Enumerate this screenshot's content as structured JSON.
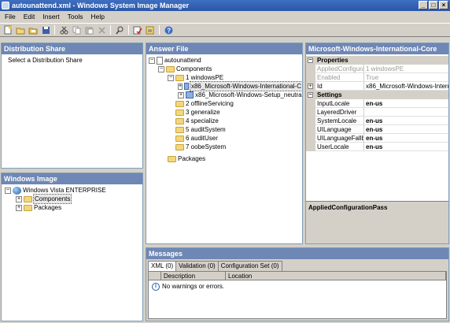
{
  "window": {
    "title": "autounattend.xml - Windows System Image Manager",
    "controls": [
      "_",
      "□",
      "×"
    ]
  },
  "menu": [
    {
      "label": "File",
      "mnemonic": "F"
    },
    {
      "label": "Edit",
      "mnemonic": "E"
    },
    {
      "label": "Insert",
      "mnemonic": "I"
    },
    {
      "label": "Tools",
      "mnemonic": "T"
    },
    {
      "label": "Help",
      "mnemonic": "H"
    }
  ],
  "toolbar": {
    "icons": [
      "new-icon",
      "open-icon",
      "open-folder-icon",
      "save-icon",
      "cut-icon",
      "copy-icon",
      "paste-icon",
      "delete-icon",
      "find-icon",
      "validate-icon",
      "create-config-set-icon",
      "help-icon"
    ]
  },
  "distribution_share": {
    "header": "Distribution Share",
    "placeholder": "Select a Distribution Share"
  },
  "windows_image": {
    "header": "Windows Image",
    "root": "Windows Vista ENTERPRISE",
    "items": [
      "Components",
      "Packages"
    ]
  },
  "answer_file": {
    "header": "Answer File",
    "root": "autounattend",
    "components_label": "Components",
    "passes": [
      {
        "label": "1 windowsPE",
        "children": [
          "x86_Microsoft-Windows-International-C",
          "x86_Microsoft-Windows-Setup_neutra"
        ]
      },
      {
        "label": "2 offlineServicing"
      },
      {
        "label": "3 generalize"
      },
      {
        "label": "4 specialize"
      },
      {
        "label": "5 auditSystem"
      },
      {
        "label": "6 auditUser"
      },
      {
        "label": "7 oobeSystem"
      }
    ],
    "packages_label": "Packages"
  },
  "properties": {
    "header": "Microsoft-Windows-International-Core",
    "categories": {
      "properties": "Properties",
      "settings": "Settings"
    },
    "property_rows": [
      {
        "name": "AppliedConfigura",
        "value": "1 windowsPE",
        "gray": true
      },
      {
        "name": "Enabled",
        "value": "True",
        "gray": true
      },
      {
        "name": "Id",
        "value": "x86_Microsoft-Windows-Internat",
        "gray": false
      }
    ],
    "settings_rows": [
      {
        "name": "InputLocale",
        "value": "en-us"
      },
      {
        "name": "LayeredDriver",
        "value": ""
      },
      {
        "name": "SystemLocale",
        "value": "en-us"
      },
      {
        "name": "UILanguage",
        "value": "en-us"
      },
      {
        "name": "UILanguageFallb",
        "value": "en-us"
      },
      {
        "name": "UserLocale",
        "value": "en-us"
      }
    ],
    "description_title": "AppliedConfigurationPass"
  },
  "messages": {
    "header": "Messages",
    "tabs": [
      "XML (0)",
      "Validation (0)",
      "Configuration Set (0)"
    ],
    "columns": [
      "Description",
      "Location"
    ],
    "rows": [
      {
        "description": "No warnings or errors.",
        "location": ""
      }
    ]
  }
}
